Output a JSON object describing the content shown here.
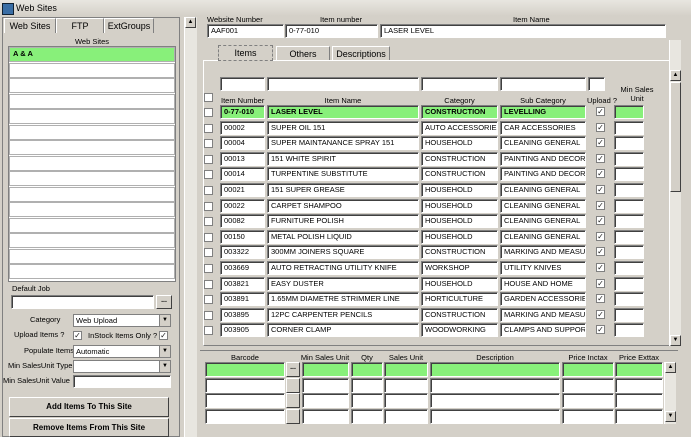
{
  "window": {
    "title": "Web Sites"
  },
  "left": {
    "tabs": [
      "Web Sites",
      "FTP",
      "ExtGroups"
    ],
    "list_header": "Web Sites",
    "sites": [
      "A & A"
    ],
    "default_job_label": "Default Job",
    "default_job_value": "",
    "ellipsis": "...",
    "category_label": "Category",
    "category_value": "Web Upload",
    "upload_items_label": "Upload Items ?",
    "instock_label": "InStock Items Only ?",
    "populate_label": "Populate Items",
    "populate_value": "Automatic",
    "min_sales_type_label": "Min SalesUnit Type",
    "min_sales_value_label": "Min SalesUnit Value",
    "add_button": "Add Items To This Site",
    "remove_button": "Remove Items From This Site"
  },
  "header": {
    "website_number_label": "Website  Number",
    "item_number_label": "Item number",
    "item_name_label": "Item Name",
    "website_number": "AAF001",
    "item_number": "0-77-010",
    "item_name": "LASER LEVEL"
  },
  "inner_tabs": [
    "Items",
    "Others",
    "Descriptions"
  ],
  "grid": {
    "columns": [
      "Item Number",
      "Item Name",
      "Category",
      "Sub Category",
      "Upload ?",
      "Min Sales Unit"
    ],
    "rows": [
      {
        "num": "0-77-010",
        "name": "LASER LEVEL",
        "cat": "CONSTRUCTION",
        "sub": "LEVELLING"
      },
      {
        "num": "00002",
        "name": "SUPER OIL 151",
        "cat": "AUTO ACCESSORIES",
        "sub": "CAR ACCESSORIES"
      },
      {
        "num": "00004",
        "name": "SUPER MAINTANANCE SPRAY 151",
        "cat": "HOUSEHOLD",
        "sub": "CLEANING GENERAL"
      },
      {
        "num": "00013",
        "name": "151 WHITE SPIRIT",
        "cat": "CONSTRUCTION",
        "sub": "PAINTING AND DECORATING"
      },
      {
        "num": "00014",
        "name": "TURPENTINE SUBSTITUTE",
        "cat": "CONSTRUCTION",
        "sub": "PAINTING AND DECORATING"
      },
      {
        "num": "00021",
        "name": "151 SUPER GREASE",
        "cat": "HOUSEHOLD",
        "sub": "CLEANING GENERAL"
      },
      {
        "num": "00022",
        "name": "CARPET SHAMPOO",
        "cat": "HOUSEHOLD",
        "sub": "CLEANING GENERAL"
      },
      {
        "num": "00082",
        "name": "FURNITURE POLISH",
        "cat": "HOUSEHOLD",
        "sub": "CLEANING GENERAL"
      },
      {
        "num": "00150",
        "name": "METAL POLISH LIQUID",
        "cat": "HOUSEHOLD",
        "sub": "CLEANING GENERAL"
      },
      {
        "num": "003322",
        "name": "300MM JOINERS SQUARE",
        "cat": "CONSTRUCTION",
        "sub": "MARKING AND MEASURING"
      },
      {
        "num": "003669",
        "name": "AUTO RETRACTING UTILITY KNIFE",
        "cat": "WORKSHOP",
        "sub": "UTILITY KNIVES"
      },
      {
        "num": "003821",
        "name": "EASY DUSTER",
        "cat": "HOUSEHOLD",
        "sub": "HOUSE AND HOME"
      },
      {
        "num": "003891",
        "name": "1.65MM DIAMETRE STRIMMER LINE",
        "cat": "HORTICULTURE",
        "sub": "GARDEN ACCESSORIES"
      },
      {
        "num": "003895",
        "name": "12PC CARPENTER PENCILS",
        "cat": "CONSTRUCTION",
        "sub": "MARKING AND MEASURING"
      },
      {
        "num": "003905",
        "name": "CORNER CLAMP",
        "cat": "WOODWORKING",
        "sub": "CLAMPS AND SUPPORT"
      }
    ]
  },
  "barcode": {
    "columns": [
      "Barcode",
      "Min Sales Unit",
      "Qty",
      "Sales Unit",
      "Description",
      "Price Inctax",
      "Price Exttax"
    ]
  },
  "icons": {
    "check": "✓",
    "up": "▲",
    "down": "▼"
  }
}
